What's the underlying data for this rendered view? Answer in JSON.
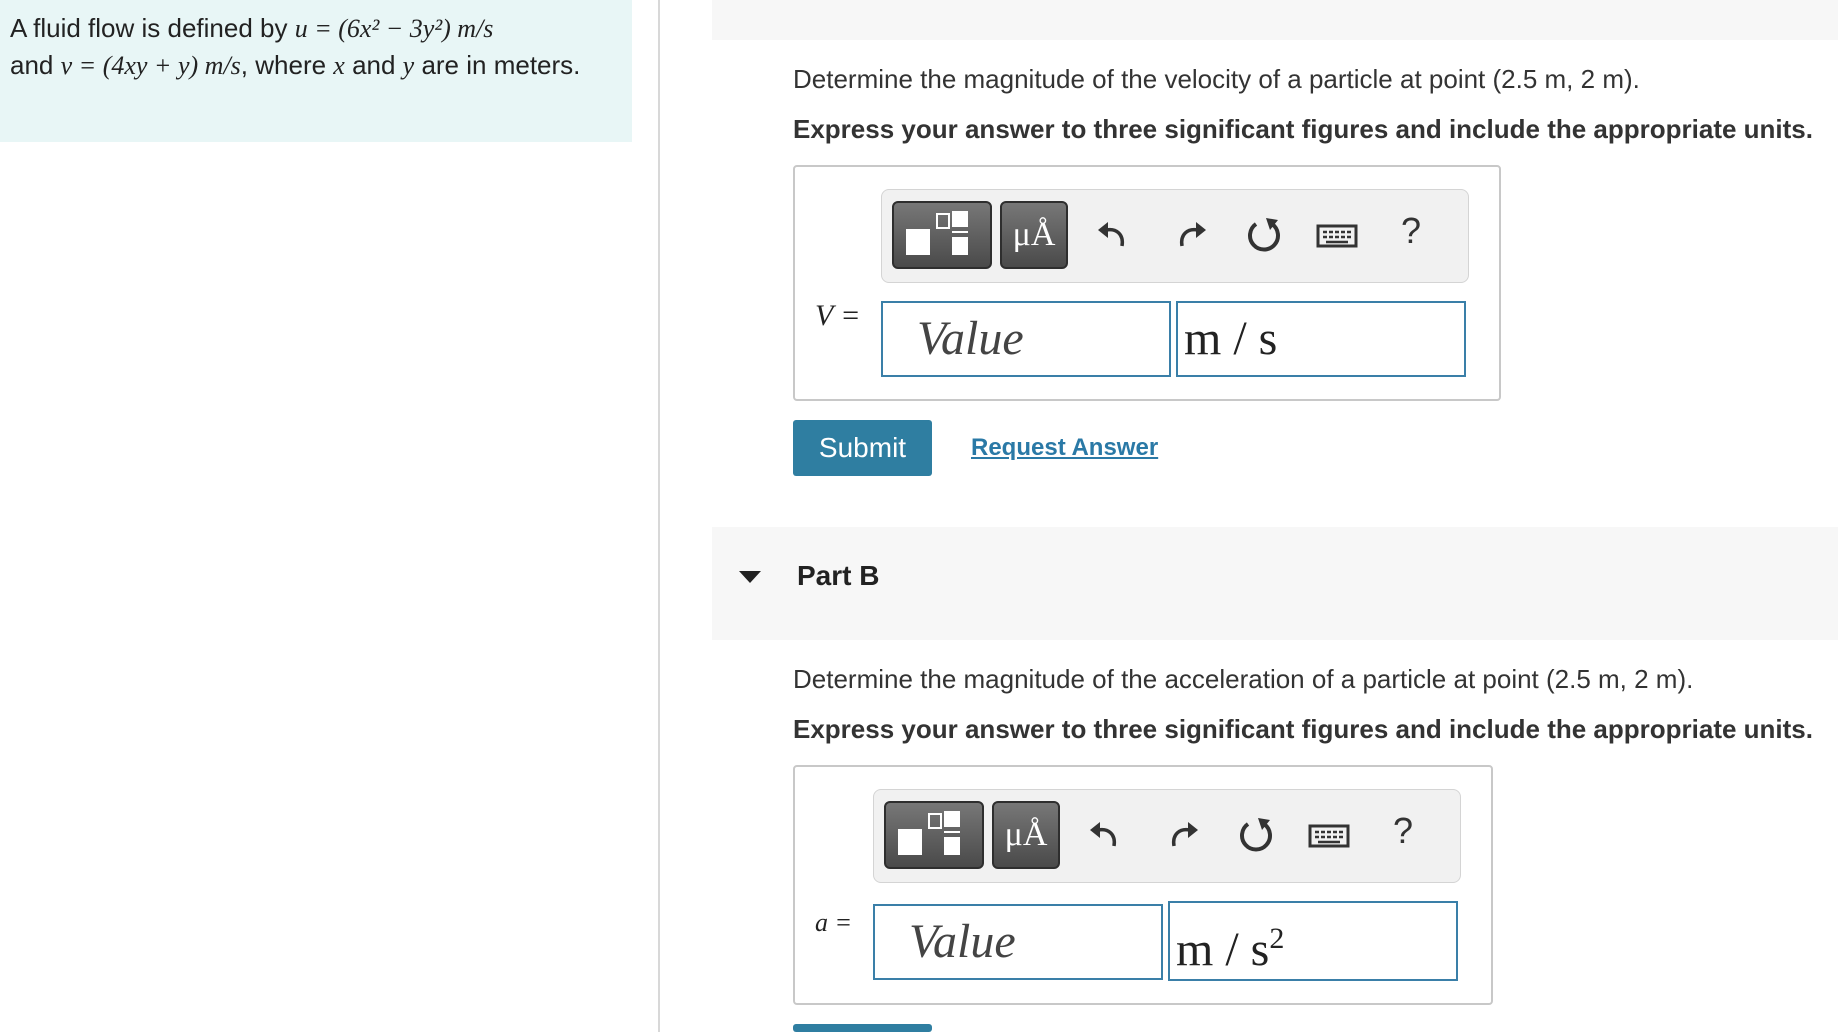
{
  "problem": {
    "t1": "A fluid flow is defined by ",
    "u_eq": "u = (6x² − 3y²) m/s",
    "t2": "and ",
    "v_eq": "v = (4xy + y) m/s",
    "t3": ", where ",
    "x": "x",
    "t4": " and ",
    "y": "y",
    "t5": " are in meters."
  },
  "partA": {
    "question": "Determine the magnitude of the velocity of a particle at point (2.5 m, 2 m).",
    "instruction": "Express your answer to three significant figures and include the appropriate units.",
    "var_label": "V =",
    "value_placeholder": "Value",
    "unit": "m / s",
    "submit_label": "Submit",
    "request_label": "Request Answer"
  },
  "partB": {
    "title": "Part B",
    "question": "Determine the magnitude of the acceleration of a particle at point (2.5 m, 2 m).",
    "instruction": "Express your answer to three significant figures and include the appropriate units.",
    "var_label": "a =",
    "value_placeholder": "Value",
    "unit": "m / s",
    "unit_exp": "2"
  },
  "toolbar": {
    "units_label": "μÅ",
    "help_label": "?",
    "icons": [
      "fraction-template-icon",
      "units-icon",
      "undo-icon",
      "redo-icon",
      "reset-icon",
      "keyboard-icon",
      "help-icon"
    ]
  },
  "colors": {
    "accent": "#2f7ea1",
    "input_border": "#3a7fa8",
    "problem_bg": "#e8f6f6"
  }
}
